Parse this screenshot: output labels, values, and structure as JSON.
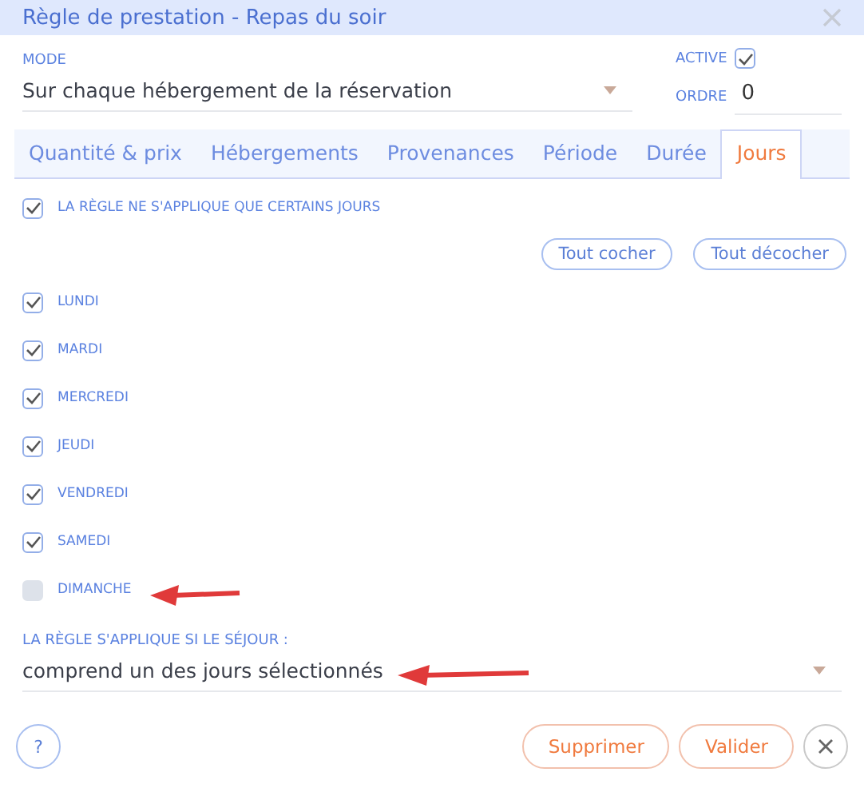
{
  "window": {
    "title": "Règle de prestation - Repas du soir"
  },
  "mode": {
    "label": "MODE",
    "value": "Sur chaque hébergement de la réservation"
  },
  "active": {
    "label": "ACTIVE",
    "checked": true
  },
  "ordre": {
    "label": "ORDRE",
    "value": "0"
  },
  "tabs": [
    {
      "label": "Quantité & prix",
      "selected": false
    },
    {
      "label": "Hébergements",
      "selected": false
    },
    {
      "label": "Provenances",
      "selected": false
    },
    {
      "label": "Période",
      "selected": false
    },
    {
      "label": "Durée",
      "selected": false
    },
    {
      "label": "Jours",
      "selected": true
    }
  ],
  "restrict": {
    "label": "LA RÈGLE NE S'APPLIQUE QUE CERTAINS JOURS",
    "checked": true
  },
  "bulk_buttons": [
    "Tout cocher",
    "Tout décocher"
  ],
  "days": [
    {
      "label": "LUNDI",
      "checked": true
    },
    {
      "label": "MARDI",
      "checked": true
    },
    {
      "label": "MERCREDI",
      "checked": true
    },
    {
      "label": "JEUDI",
      "checked": true
    },
    {
      "label": "VENDREDI",
      "checked": true
    },
    {
      "label": "SAMEDI",
      "checked": true
    },
    {
      "label": "DIMANCHE",
      "checked": false
    }
  ],
  "condition": {
    "label": "LA RÈGLE S'APPLIQUE SI LE SÉJOUR :",
    "value": "comprend un des jours sélectionnés"
  },
  "footer": {
    "help": "?",
    "buttons": [
      "Supprimer",
      "Valider"
    ]
  }
}
